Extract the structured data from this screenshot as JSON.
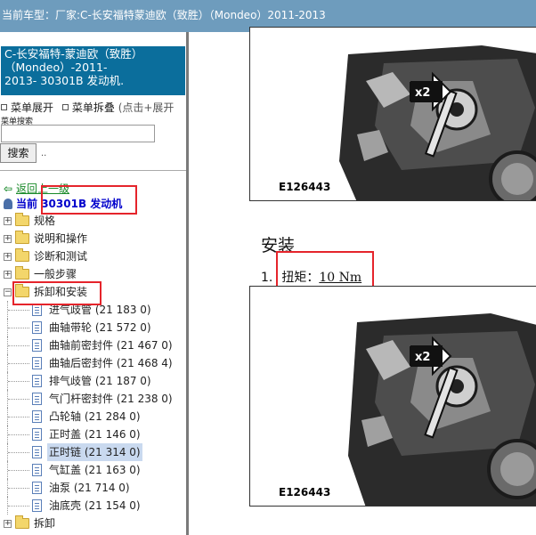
{
  "topbar": {
    "label": "当前车型：",
    "vehicle": "厂家:C-长安福特蒙迪欧（致胜）（Mondeo）2011-2013"
  },
  "sidebar": {
    "vehicle_line1": "C-长安福特-蒙迪欧（致胜）",
    "vehicle_line2": "（Mondeo）-2011-",
    "vehicle_line3": "2013- 30301B 发动机.",
    "menu_expand": "菜单展开",
    "menu_collapse": "菜单拆叠",
    "menu_hint": "(点击+展开",
    "search_label": "菜单搜索",
    "search_value": "",
    "search_button": "搜索",
    "search_dots": "..",
    "back_label": "返回上一级",
    "current_label": "当前",
    "current_value": "30301B 发动机",
    "tree": [
      {
        "label": "规格"
      },
      {
        "label": "说明和操作"
      },
      {
        "label": "诊断和测试"
      },
      {
        "label": "一般步骤"
      },
      {
        "label": "拆卸和安装"
      }
    ],
    "children": [
      {
        "label": "进气歧管 (21 183 0)"
      },
      {
        "label": "曲轴带轮 (21 572 0)"
      },
      {
        "label": "曲轴前密封件 (21 467 0)"
      },
      {
        "label": "曲轴后密封件 (21 468 4)"
      },
      {
        "label": "排气歧管 (21 187 0)"
      },
      {
        "label": "气门杆密封件 (21 238 0)"
      },
      {
        "label": "凸轮轴 (21 284 0)"
      },
      {
        "label": "正时盖 (21 146 0)"
      },
      {
        "label": "正时链 (21 314 0)"
      },
      {
        "label": "气缸盖 (21 163 0)"
      },
      {
        "label": "油泵 (21 714 0)"
      },
      {
        "label": "油底壳 (21 154 0)"
      }
    ],
    "last_item": "拆卸"
  },
  "content": {
    "figure_top_caption": "E126443",
    "figure_top_badge": "x2",
    "section_title": "安装",
    "step_number": "1.",
    "step_key": "扭矩：",
    "step_value": "10 Nm",
    "figure_bottom_caption": "E126443",
    "figure_bottom_badge": "x2"
  },
  "colors": {
    "topbar": "#6e9cbd",
    "vehicle_box": "#0b6e9c",
    "highlight_box": "#e5242b",
    "link_green": "#1a8a2a",
    "current_blue": "#0000cc"
  }
}
